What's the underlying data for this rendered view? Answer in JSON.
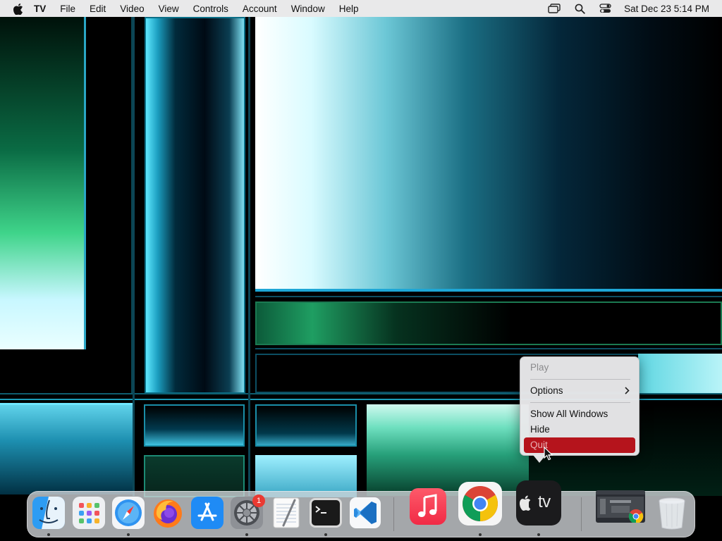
{
  "menubar": {
    "app_name": "TV",
    "items": [
      "File",
      "Edit",
      "Video",
      "View",
      "Controls",
      "Account",
      "Window",
      "Help"
    ],
    "clock": "Sat Dec 23  5:14 PM",
    "status_icons": [
      "screen-mirroring-icon",
      "search-icon",
      "control-center-icon"
    ]
  },
  "context_menu": {
    "items": [
      {
        "label": "Play",
        "enabled": false
      },
      {
        "label": "Options",
        "submenu": true
      },
      {
        "label": "Show All Windows"
      },
      {
        "label": "Hide"
      },
      {
        "label": "Quit",
        "highlighted": true
      }
    ]
  },
  "dock": {
    "apps": [
      {
        "name": "Finder",
        "icon": "finder-icon",
        "running": true
      },
      {
        "name": "Launchpad",
        "icon": "launchpad-icon",
        "running": false
      },
      {
        "name": "Safari",
        "icon": "safari-icon",
        "running": true
      },
      {
        "name": "Firefox",
        "icon": "firefox-icon",
        "running": false
      },
      {
        "name": "App Store",
        "icon": "app-store-icon",
        "running": false
      },
      {
        "name": "System Settings",
        "icon": "settings-icon",
        "running": true,
        "badge": "1"
      },
      {
        "name": "TextEdit",
        "icon": "textedit-icon",
        "running": false
      },
      {
        "name": "Terminal",
        "icon": "terminal-icon",
        "running": true
      },
      {
        "name": "Visual Studio Code",
        "icon": "vscode-icon",
        "running": false
      },
      {
        "name": "Music",
        "icon": "music-icon",
        "running": false
      },
      {
        "name": "Google Chrome",
        "icon": "chrome-icon",
        "running": true
      },
      {
        "name": "TV",
        "icon": "tv-icon",
        "running": true,
        "label": "tv"
      },
      {
        "name": "Chrome Window",
        "icon": "minimized-window-icon",
        "running": false
      },
      {
        "name": "Trash",
        "icon": "trash-icon",
        "running": false
      }
    ]
  },
  "colors": {
    "menu_highlight": "#b5141c",
    "menubar_bg": "#e9e9ea",
    "badge": "#ea3a32"
  }
}
